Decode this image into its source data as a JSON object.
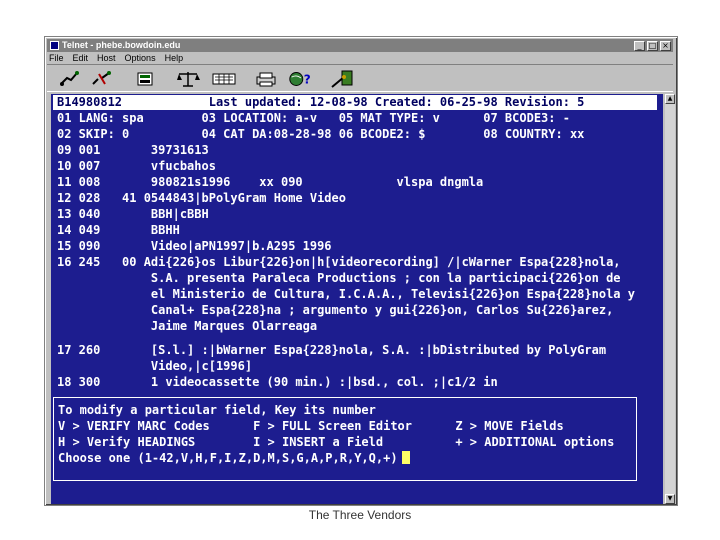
{
  "window": {
    "title": "Telnet - phebe.bowdoin.edu",
    "minimize": "_",
    "maximize": "□",
    "close": "×"
  },
  "menu": [
    "File",
    "Edit",
    "Host",
    "Options",
    "Help"
  ],
  "toolbar": {
    "icons": [
      "connect-icon",
      "disconnect-icon",
      "keyboard-icon",
      "scales-icon",
      "keypad-icon",
      "printer-icon",
      "globe-help-icon",
      "macro-icon"
    ]
  },
  "screen": {
    "header": "B14980812            Last updated: 12-08-98 Created: 06-25-98 Revision: 5",
    "lines": [
      "01 LANG: spa        03 LOCATION: a-v   05 MAT TYPE: v      07 BCODE3: -",
      "02 SKIP: 0          04 CAT DA:08-28-98 06 BCODE2: $        08 COUNTRY: xx",
      "09 001       39731613",
      "10 007       vfucbahos",
      "11 008       980821s1996    xx 090             vlspa dngmla",
      "12 028   41 0544843|bPolyGram Home Video",
      "13 040       BBH|cBBH",
      "14 049       BBHH",
      "15 090       Video|aPN1997|b.A295 1996",
      "16 245   00 Adi{226}os Libur{226}on|h[videorecording] /|cWarner Espa{228}nola,",
      "             S.A. presenta Paraleca Productions ; con la participaci{226}on de",
      "             el Ministerio de Cultura, I.C.A.A., Televisi{226}on Espa{228}nola y",
      "             Canal+ Espa{228}na ; argumento y gui{226}on, Carlos Su{226}arez,",
      "             Jaime Marques Olarreaga",
      "17 260       [S.l.] :|bWarner Espa{228}nola, S.A. :|bDistributed by PolyGram",
      "             Video,|c[1996]",
      "18 300       1 videocassette (90 min.) :|bsd., col. ;|c1/2 in"
    ],
    "prompt": [
      "To modify a particular field, Key its number",
      "V > VERIFY MARC Codes      F > FULL Screen Editor      Z > MOVE Fields",
      "H > Verify HEADINGS        I > INSERT a Field          + > ADDITIONAL options",
      "Choose one (1-42,V,H,F,I,Z,D,M,S,G,A,P,R,Y,Q,+)"
    ]
  },
  "caption": "The Three Vendors",
  "colors": {
    "screen_bg": "#1d1d8f",
    "text": "#ffffff",
    "cursor": "#ffff66"
  }
}
